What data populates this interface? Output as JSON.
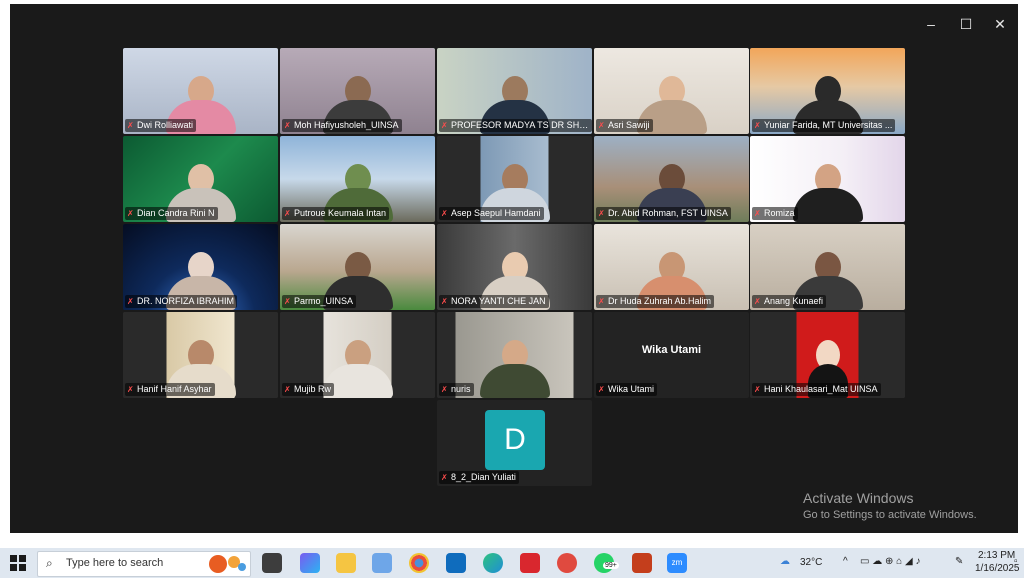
{
  "window": {
    "controls": {
      "minimize": "–",
      "maximize": "☐",
      "close": "✕"
    }
  },
  "participants": [
    {
      "name": "Dwi Rolliawati"
    },
    {
      "name": "Moh Hafiyusholeh_UINSA"
    },
    {
      "name": "PROFESOR MADYA TS DR SHUK..."
    },
    {
      "name": "Asri Sawiji"
    },
    {
      "name": "Yuniar Farida, MT Universitas ..."
    },
    {
      "name": "Dian Candra Rini N"
    },
    {
      "name": "Putroue Keumala Intan"
    },
    {
      "name": "Asep Saepul Hamdani"
    },
    {
      "name": "Dr. Abid Rohman, FST UINSA"
    },
    {
      "name": "Romiza"
    },
    {
      "name": "DR. NORFIZA IBRAHIM"
    },
    {
      "name": "Parmo_UINSA"
    },
    {
      "name": "NORA YANTI CHE JAN"
    },
    {
      "name": "Dr Huda Zuhrah Ab.Halim"
    },
    {
      "name": "Anang Kunaefi"
    },
    {
      "name": "Hanif Hanif Asyhar"
    },
    {
      "name": "Mujib Rw"
    },
    {
      "name": "nuris"
    },
    {
      "name": "Wika Utami",
      "card_name": "Wika Utami"
    },
    {
      "name": "Hani Khaulasari_Mat UINSA"
    },
    {
      "name": "8_2_Dian Yuliati",
      "avatar_letter": "D"
    }
  ],
  "watermark": {
    "title": "Activate Windows",
    "subtitle": "Go to Settings to activate Windows."
  },
  "taskbar": {
    "search_placeholder": "Type here to search",
    "badge_count": "99+",
    "weather": "32°C",
    "time": "2:13 PM",
    "date": "1/16/2025",
    "zoom_label": "zm"
  }
}
